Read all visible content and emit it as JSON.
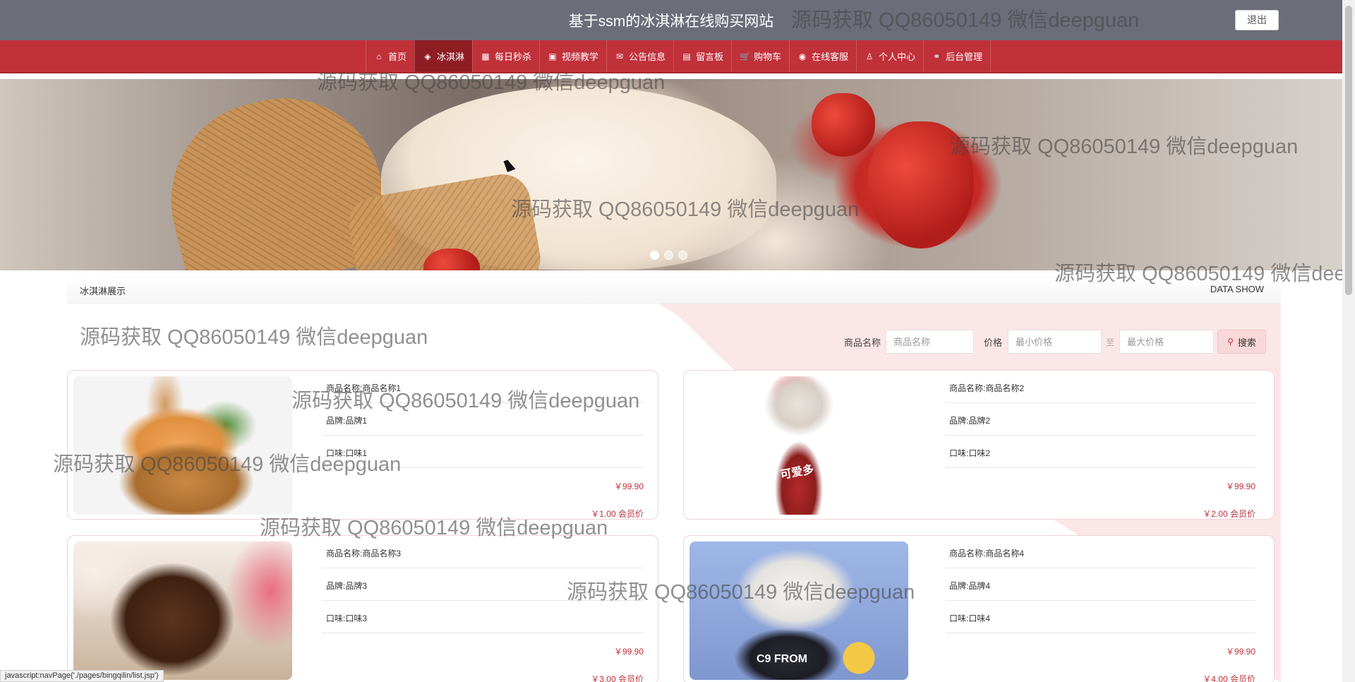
{
  "header": {
    "title": "基于ssm的冰淇淋在线购买网站",
    "logout_label": "退出"
  },
  "nav": {
    "items": [
      {
        "label": "首页",
        "icon": "home-icon",
        "glyph": "⌂"
      },
      {
        "label": "冰淇淋",
        "icon": "layers-icon",
        "glyph": "◈"
      },
      {
        "label": "每日秒杀",
        "icon": "calendar-icon",
        "glyph": "▦"
      },
      {
        "label": "视频教学",
        "icon": "grid-icon",
        "glyph": "▣"
      },
      {
        "label": "公告信息",
        "icon": "mail-icon",
        "glyph": "✉"
      },
      {
        "label": "留言板",
        "icon": "document-icon",
        "glyph": "▤"
      },
      {
        "label": "购物车",
        "icon": "cart-icon",
        "glyph": "🛒"
      },
      {
        "label": "在线客服",
        "icon": "chat-icon",
        "glyph": "◉"
      },
      {
        "label": "个人中心",
        "icon": "user-icon",
        "glyph": "♙"
      },
      {
        "label": "后台管理",
        "icon": "link-icon",
        "glyph": "⚭"
      }
    ],
    "active_index": 1,
    "accent_color": "#c0313a",
    "active_color": "#8f1d24"
  },
  "banner": {
    "slides_count": 3,
    "active_slide": 0
  },
  "section": {
    "title": "冰淇淋展示",
    "subtitle": "DATA SHOW"
  },
  "search": {
    "name_label": "商品名称",
    "name_placeholder": "商品名称",
    "price_label": "价格",
    "min_placeholder": "最小价格",
    "range_sep": "至",
    "max_placeholder": "最大价格",
    "button_label": "搜索"
  },
  "products": [
    {
      "name": "商品名称:商品名称1",
      "brand": "品牌:品牌1",
      "flavor": "口味:口味1",
      "price": "￥99.90",
      "member_price": "￥1.00 会员价"
    },
    {
      "name": "商品名称:商品名称2",
      "brand": "品牌:品牌2",
      "flavor": "口味:口味2",
      "price": "￥99.90",
      "member_price": "￥2.00 会员价"
    },
    {
      "name": "商品名称:商品名称3",
      "brand": "品牌:品牌3",
      "flavor": "口味:口味3",
      "price": "￥99.90",
      "member_price": "￥3.00 会员价"
    },
    {
      "name": "商品名称:商品名称4",
      "brand": "品牌:品牌4",
      "flavor": "口味:口味4",
      "price": "￥99.90",
      "member_price": "￥4.00 会员价"
    }
  ],
  "image_marks": {
    "product2": "可爱多",
    "product4": "C9 FROM"
  },
  "watermark_text": "源码获取 QQ86050149 微信deepguan",
  "status_bar": "javascript:navPage('./pages/bingqilin/list.jsp')"
}
